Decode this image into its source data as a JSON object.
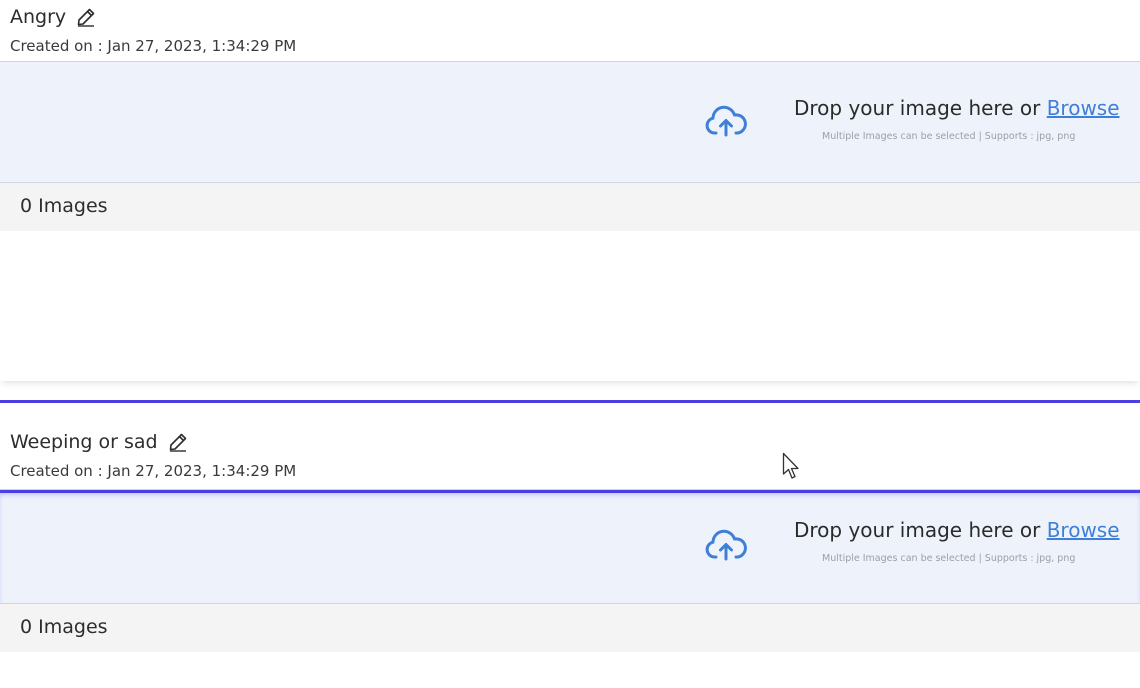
{
  "categories": [
    {
      "title": "Angry",
      "created": "Created on : Jan 27, 2023, 1:34:29 PM",
      "drop_text": "Drop your image here or",
      "browse_label": "Browse",
      "drop_subtext": "Multiple Images can be selected | Supports : jpg, png",
      "image_count": "0 Images"
    },
    {
      "title": "Weeping or sad",
      "created": "Created on : Jan 27, 2023, 1:34:29 PM",
      "drop_text": "Drop your image here or",
      "browse_label": "Browse",
      "drop_subtext": "Multiple Images can be selected | Supports : jpg, png",
      "image_count": "0 Images"
    }
  ],
  "icons": {
    "edit": "pencil-icon",
    "upload": "cloud-upload-icon",
    "cursor": "mouse-pointer-icon"
  },
  "colors": {
    "accent_link": "#3f7fd8",
    "selection_border": "#4a3fe0",
    "dropzone_bg": "#eef3fb"
  }
}
